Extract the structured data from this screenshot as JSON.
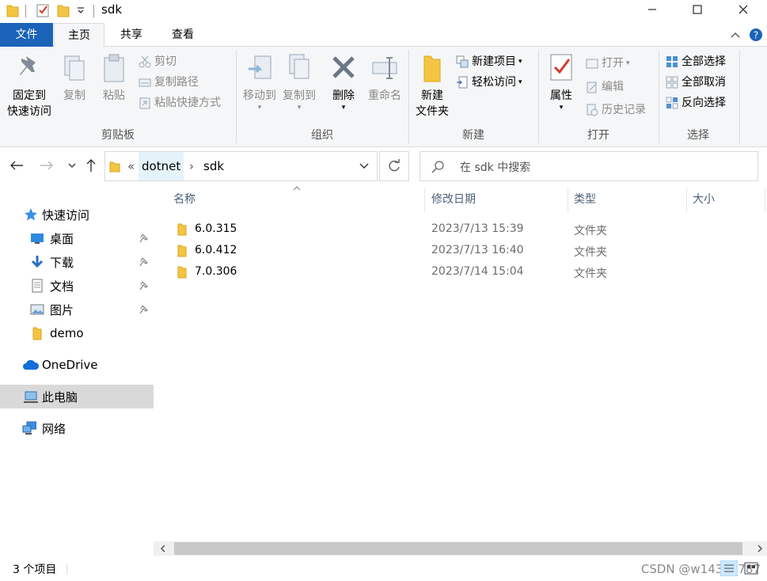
{
  "window": {
    "title": "sdk",
    "minimize_glyph": "—",
    "maximize_glyph": "☐",
    "close_glyph": "✕"
  },
  "ribbon_tabs": {
    "file": "文件",
    "home": "主页",
    "share": "共享",
    "view": "查看"
  },
  "ribbon": {
    "clipboard": {
      "pin_quick_access_line1": "固定到",
      "pin_quick_access_line2": "快速访问",
      "copy": "复制",
      "paste": "粘贴",
      "cut": "剪切",
      "copy_path": "复制路径",
      "paste_shortcut": "粘贴快捷方式",
      "label": "剪贴板"
    },
    "organize": {
      "move_to": "移动到",
      "copy_to": "复制到",
      "delete": "删除",
      "rename": "重命名",
      "label": "组织"
    },
    "new": {
      "new_folder_line1": "新建",
      "new_folder_line2": "文件夹",
      "new_item": "新建项目",
      "easy_access": "轻松访问",
      "label": "新建"
    },
    "open": {
      "properties": "属性",
      "open": "打开",
      "edit": "编辑",
      "history": "历史记录",
      "label": "打开"
    },
    "select": {
      "select_all": "全部选择",
      "select_none": "全部取消",
      "invert": "反向选择",
      "label": "选择"
    }
  },
  "address": {
    "overflow": "«",
    "crumbs": [
      "dotnet",
      "sdk"
    ],
    "separator": "›",
    "search_placeholder": "在 sdk 中搜索"
  },
  "nav_pane": {
    "quick_access": "快速访问",
    "items": [
      {
        "label": "桌面",
        "pinned": true
      },
      {
        "label": "下载",
        "pinned": true
      },
      {
        "label": "文档",
        "pinned": true
      },
      {
        "label": "图片",
        "pinned": true
      },
      {
        "label": "demo",
        "pinned": false
      }
    ],
    "onedrive": "OneDrive",
    "this_pc": "此电脑",
    "network": "网络"
  },
  "columns": {
    "name": "名称",
    "modified": "修改日期",
    "type": "类型",
    "size": "大小"
  },
  "files": [
    {
      "name": "6.0.315",
      "modified": "2023/7/13 15:39",
      "type": "文件夹"
    },
    {
      "name": "6.0.412",
      "modified": "2023/7/13 16:40",
      "type": "文件夹"
    },
    {
      "name": "7.0.306",
      "modified": "2023/7/14 15:04",
      "type": "文件夹"
    }
  ],
  "status": {
    "item_count": "3 个项目",
    "watermark": "CSDN @w14379787"
  },
  "colors": {
    "accent": "#1a63b8",
    "folder": "#f4c542",
    "selected_nav": "#d9d9d9"
  }
}
